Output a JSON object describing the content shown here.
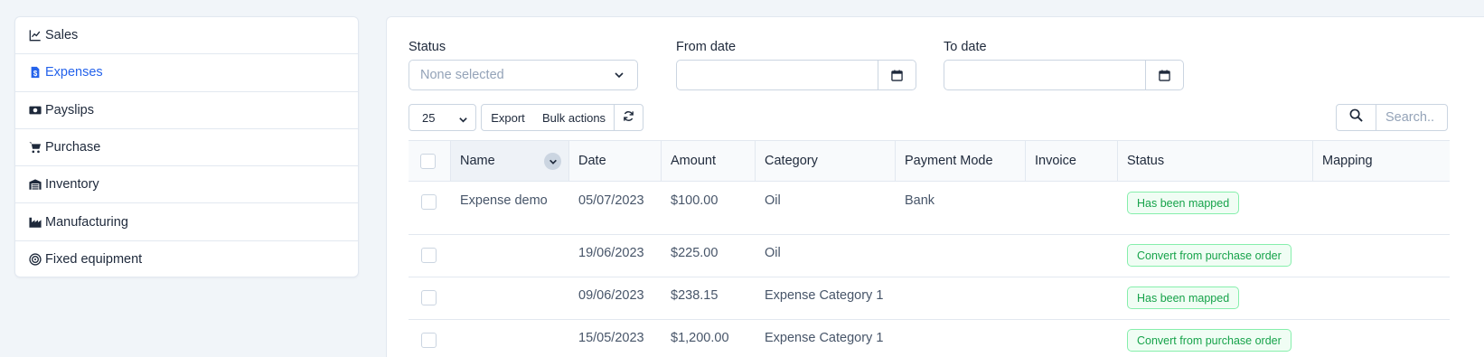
{
  "sidebar": {
    "items": [
      {
        "label": "Sales",
        "icon": "chart-line-icon",
        "active": false
      },
      {
        "label": "Expenses",
        "icon": "receipt-icon",
        "active": true
      },
      {
        "label": "Payslips",
        "icon": "money-bill-icon",
        "active": false
      },
      {
        "label": "Purchase",
        "icon": "cart-icon",
        "active": false
      },
      {
        "label": "Inventory",
        "icon": "warehouse-icon",
        "active": false
      },
      {
        "label": "Manufacturing",
        "icon": "industry-icon",
        "active": false
      },
      {
        "label": "Fixed equipment",
        "icon": "target-icon",
        "active": false
      }
    ]
  },
  "filters": {
    "status_label": "Status",
    "status_placeholder": "None selected",
    "from_date_label": "From date",
    "to_date_label": "To date"
  },
  "toolbar": {
    "page_size": "25",
    "export_label": "Export",
    "bulk_label": "Bulk actions",
    "search_placeholder": "Search.."
  },
  "table": {
    "headers": [
      "Name",
      "Date",
      "Amount",
      "Category",
      "Payment Mode",
      "Invoice",
      "Status",
      "Mapping"
    ],
    "rows": [
      {
        "name": "Expense demo",
        "date": "05/07/2023",
        "amount": "$100.00",
        "category": "Oil",
        "payment_mode": "Bank",
        "invoice": "",
        "status": "Has been mapped",
        "mapping": ""
      },
      {
        "name": "",
        "date": "19/06/2023",
        "amount": "$225.00",
        "category": "Oil",
        "payment_mode": "",
        "invoice": "",
        "status": "Convert from purchase order",
        "mapping": ""
      },
      {
        "name": "",
        "date": "09/06/2023",
        "amount": "$238.15",
        "category": "Expense Category 1",
        "payment_mode": "",
        "invoice": "",
        "status": "Has been mapped",
        "mapping": ""
      },
      {
        "name": "",
        "date": "15/05/2023",
        "amount": "$1,200.00",
        "category": "Expense Category 1",
        "payment_mode": "",
        "invoice": "",
        "status": "Convert from purchase order",
        "mapping": ""
      }
    ]
  },
  "colors": {
    "accent": "#2563eb",
    "badge_green": "#16a34a",
    "badge_bg": "#f0fdf4",
    "badge_border": "#86efac"
  }
}
